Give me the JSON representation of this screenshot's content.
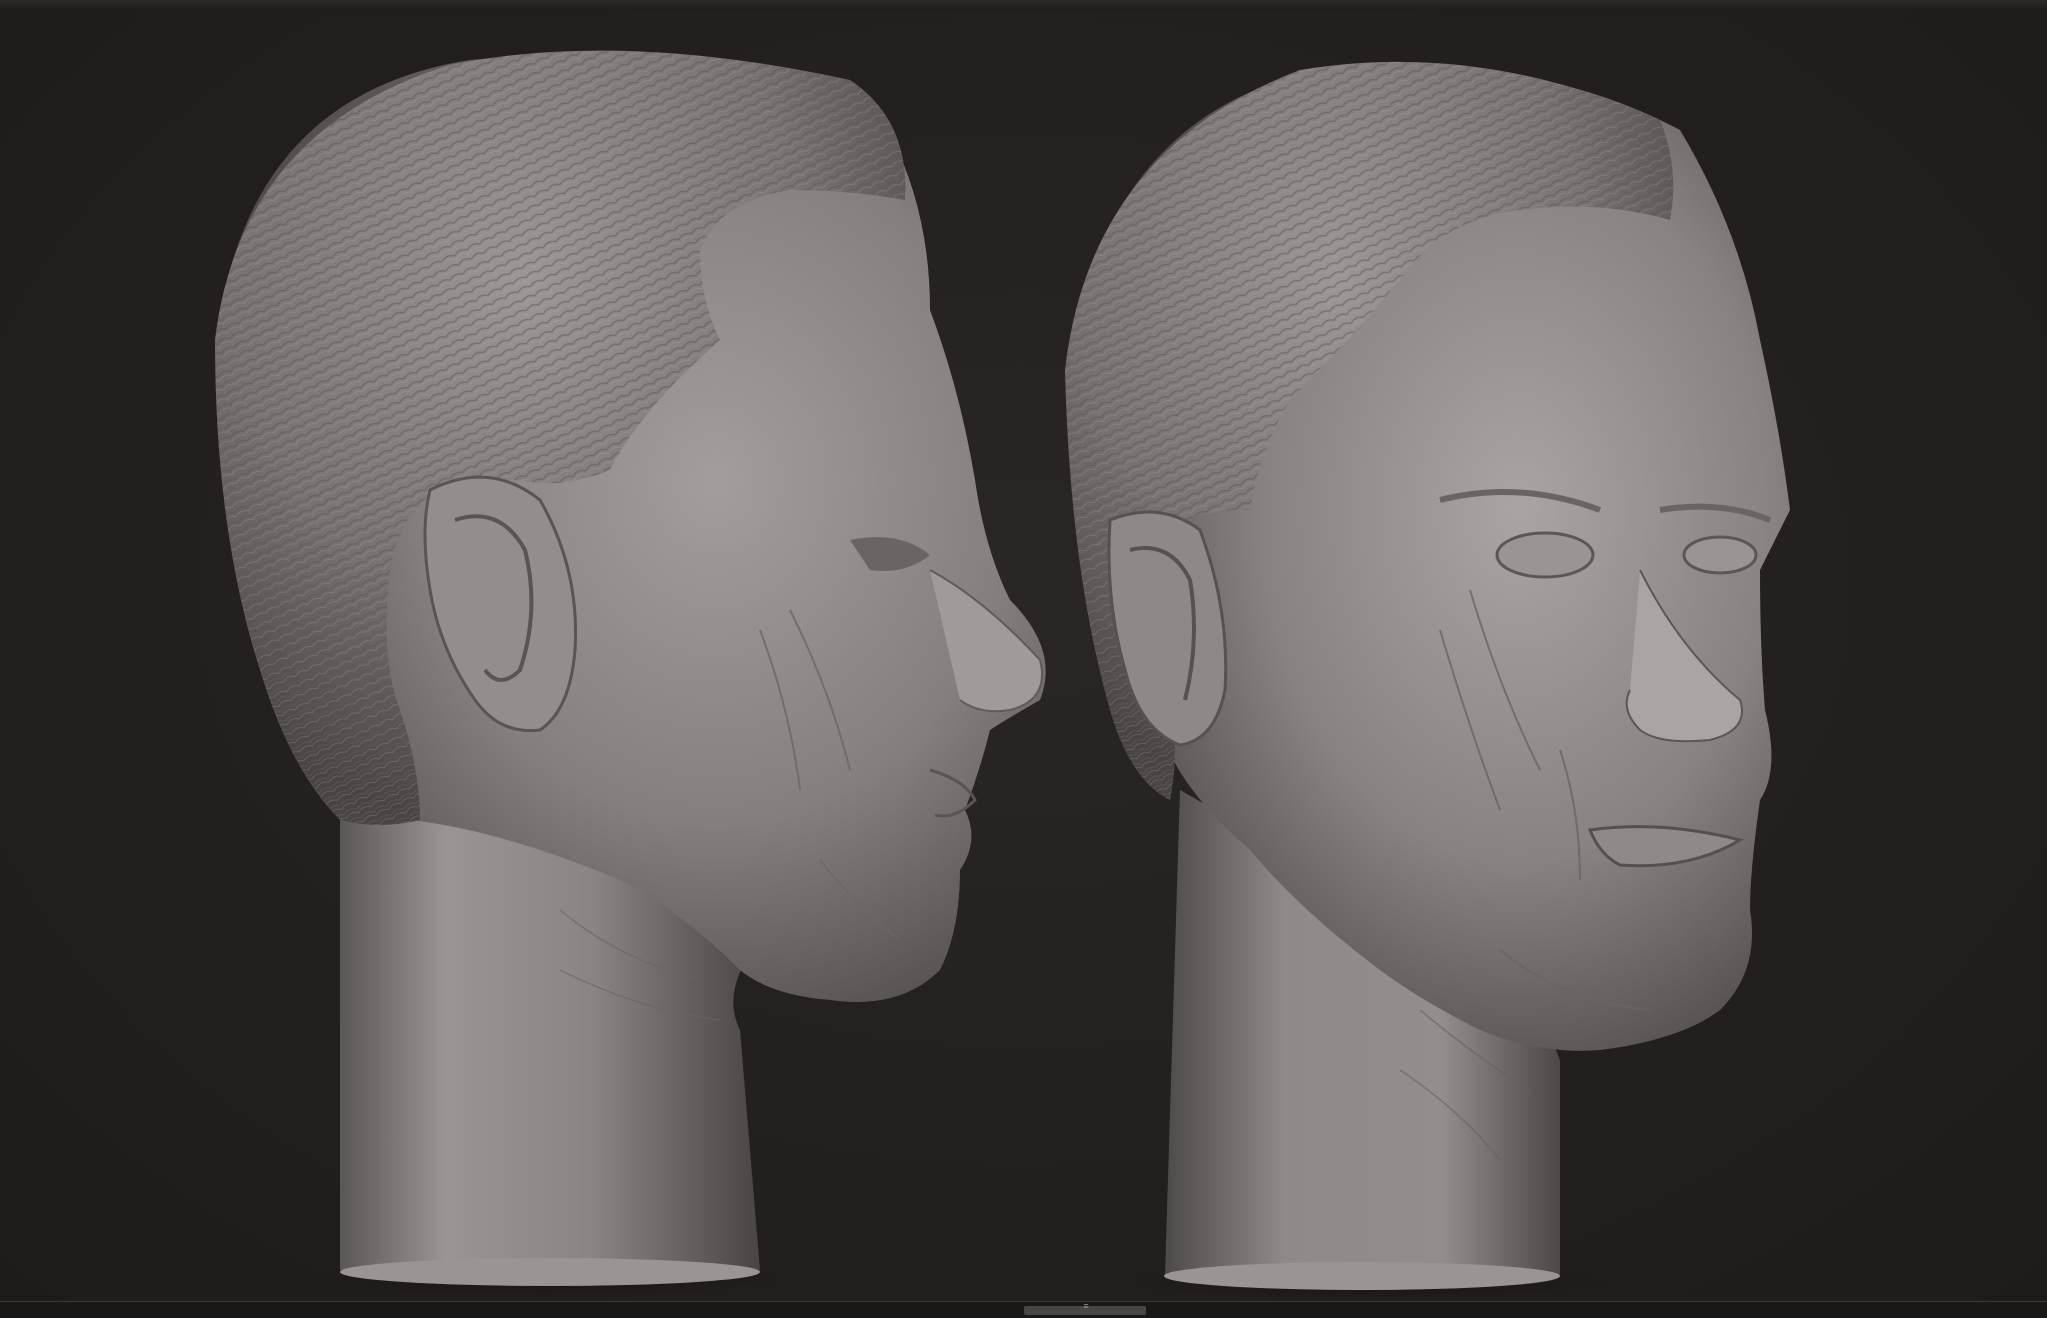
{
  "viewport": {
    "background": "#231f1f",
    "sculpt_material": "#8a8585",
    "models": [
      {
        "view": "side-profile"
      },
      {
        "view": "three-quarter"
      }
    ]
  },
  "bottom_bar": {
    "scroll_grip_icon": "grip-icon",
    "scroll_grip_glyph": "≡"
  }
}
